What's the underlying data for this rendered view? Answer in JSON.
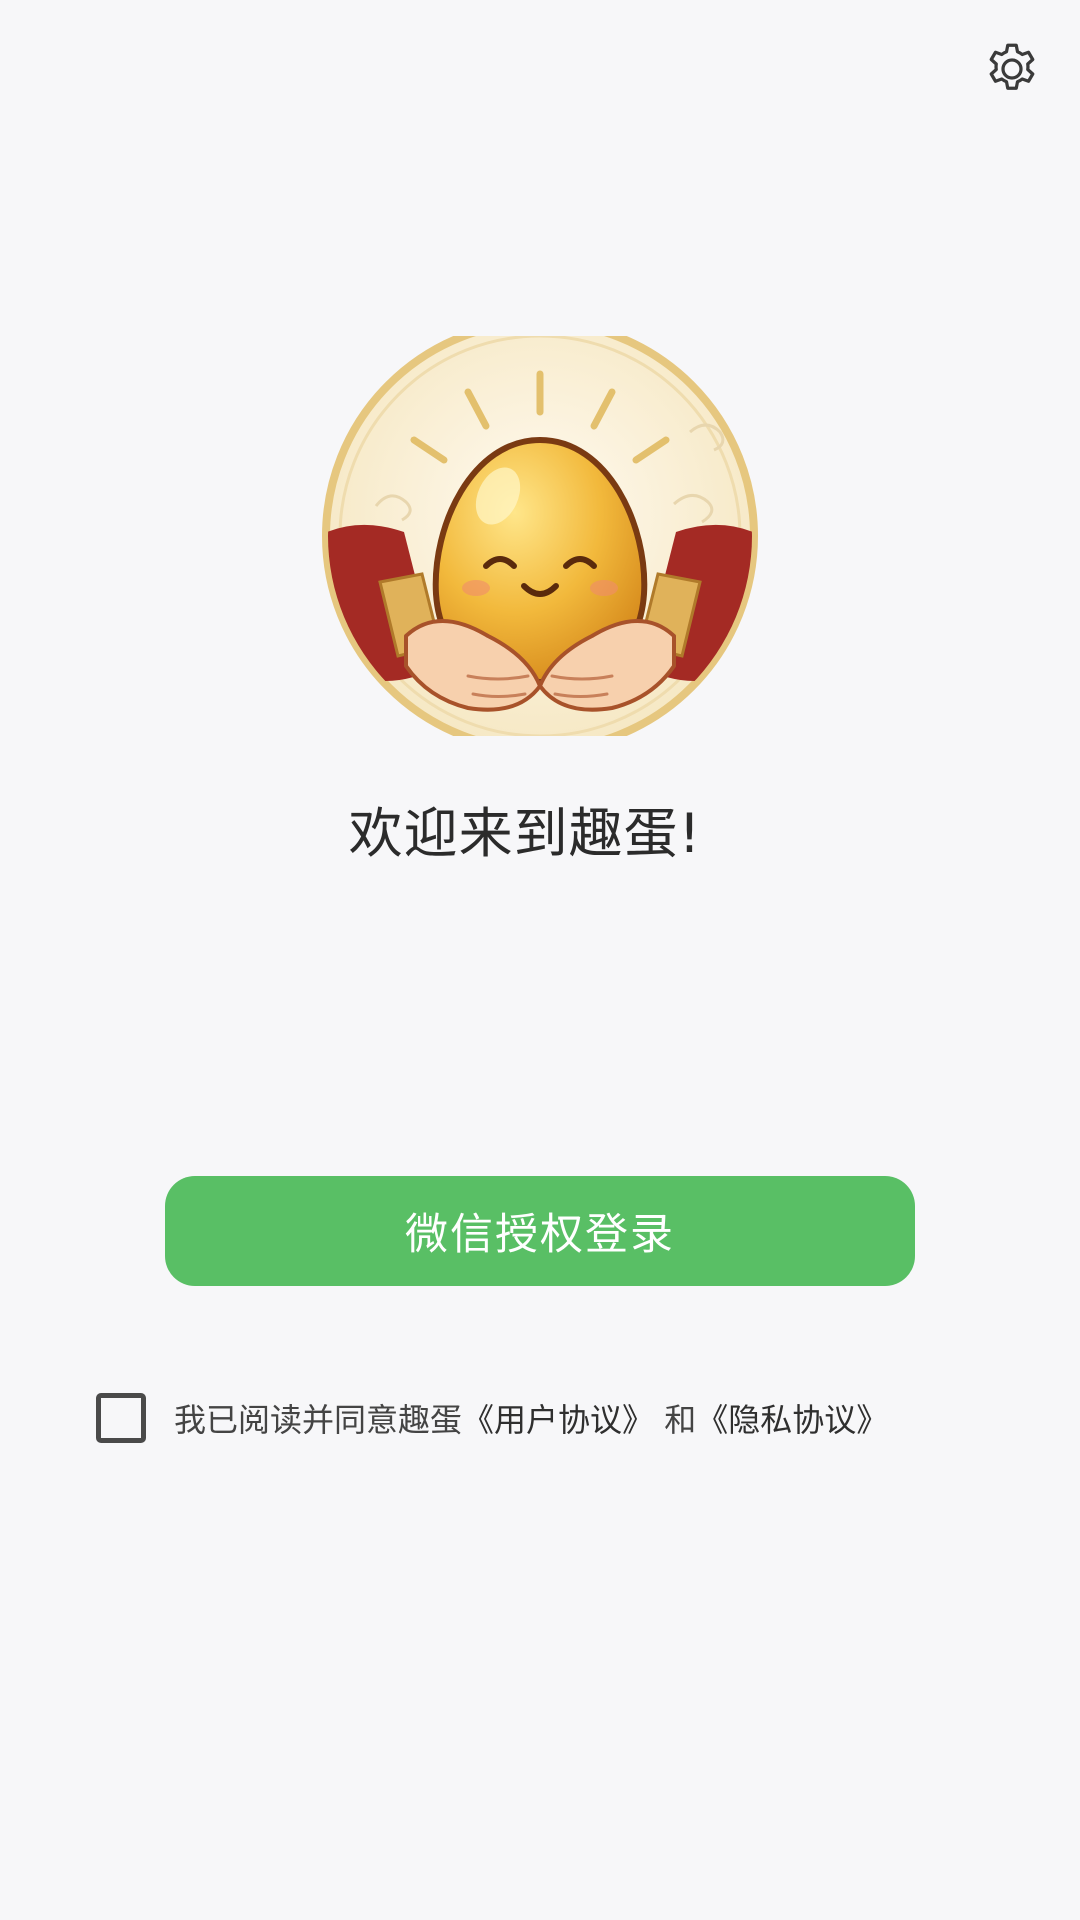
{
  "header": {
    "settings_icon": "gear-icon"
  },
  "logo": {
    "description_icon": "egg-mascot-logo",
    "colors": {
      "halo": "#fbf3dc",
      "rim": "#e2c27a",
      "robe": "#a42a24",
      "egg": "#f0b43a",
      "hands": "#f7d0ad"
    }
  },
  "welcome": {
    "text": "欢迎来到趣蛋!"
  },
  "login": {
    "button_label": "微信授权登录",
    "color": "#59bf65"
  },
  "agreement": {
    "checked": false,
    "prefix": "我已阅读并同意趣蛋",
    "user_agreement_link": "《用户协议》",
    "connector": "和",
    "privacy_link": "《隐私协议》"
  }
}
